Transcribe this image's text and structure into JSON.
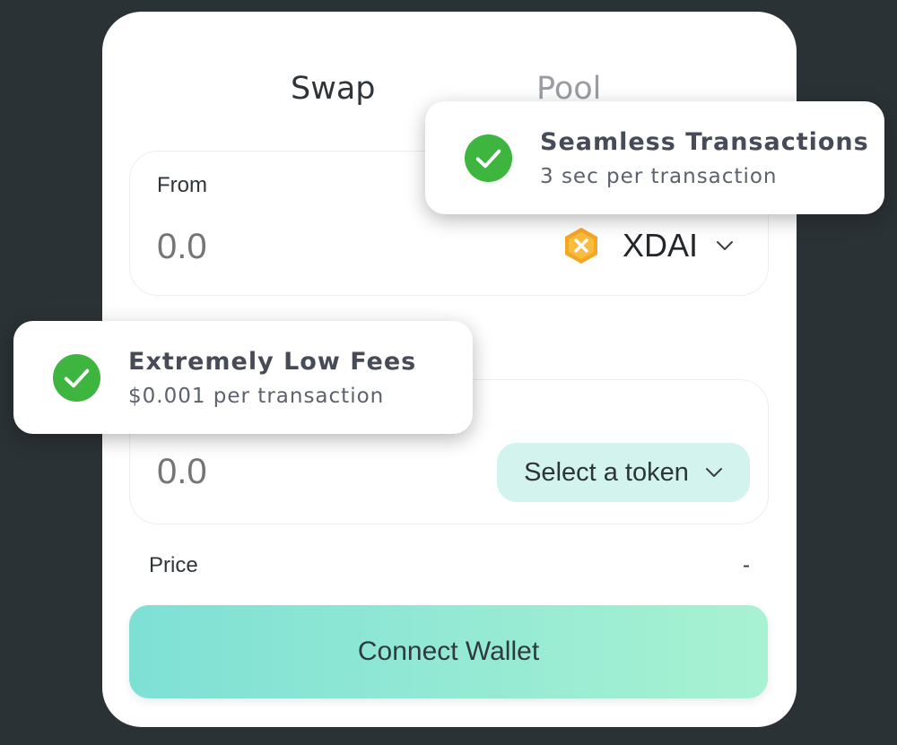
{
  "tabs": {
    "swap_label": "Swap",
    "pool_label": "Pool"
  },
  "from": {
    "label": "From",
    "amount_placeholder": "0.0",
    "token": {
      "name": "XDAI",
      "icon": "xdai-token-icon",
      "icon_color": "#F5A623"
    }
  },
  "to": {
    "amount_placeholder": "0.0",
    "select_token_label": "Select a token"
  },
  "price": {
    "label": "Price",
    "value": "-"
  },
  "connect_wallet": {
    "label": "Connect Wallet"
  },
  "toasts": {
    "seamless": {
      "title": "Seamless Transactions",
      "subtitle": "3 sec per transaction",
      "icon": "check-circle-icon"
    },
    "fees": {
      "title": "Extremely Low Fees",
      "subtitle": "$0.001 per transaction",
      "icon": "check-circle-icon"
    }
  },
  "colors": {
    "background": "#2B3236",
    "check_green": "#3DB53F",
    "select_token_bg": "#D3F3EF",
    "button_gradient_start": "#7EE0D5",
    "button_gradient_end": "#A8F2D2"
  }
}
